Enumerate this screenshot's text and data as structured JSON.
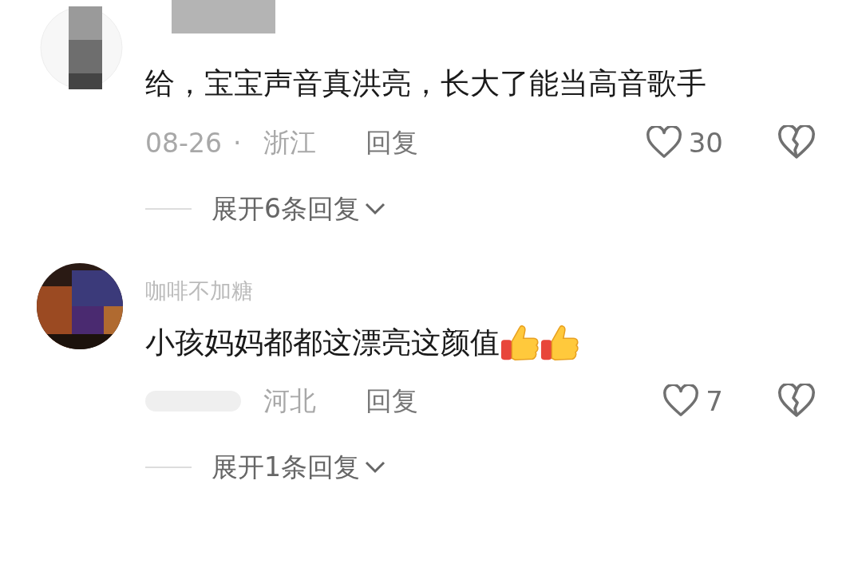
{
  "comments": [
    {
      "text": "给，宝宝声音真洪亮，长大了能当高音歌手",
      "date": "08-26",
      "separator": "·",
      "region": "浙江",
      "reply_label": "回复",
      "likes": "30",
      "expand_label": "展开6条回复"
    },
    {
      "username": "咖啡不加糖",
      "text": "小孩妈妈都都这漂亮这颜值",
      "trailing_icons": [
        {
          "kind": "thumbs-up"
        },
        {
          "kind": "thumbs-up"
        }
      ],
      "date_hidden": true,
      "region": "河北",
      "reply_label": "回复",
      "likes": "7",
      "expand_label": "展开1条回复"
    }
  ]
}
